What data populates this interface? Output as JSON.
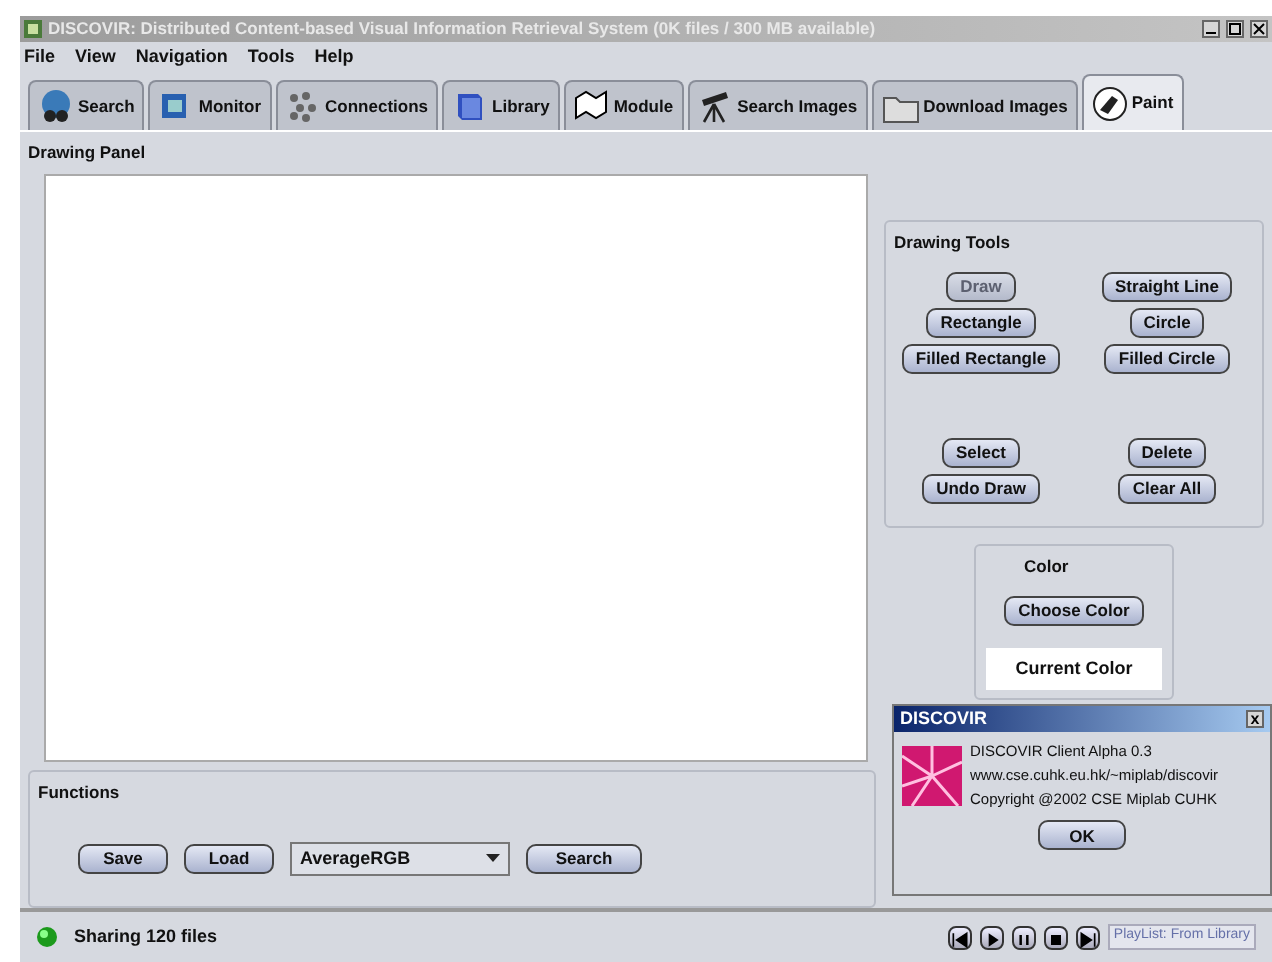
{
  "window": {
    "title": "DISCOVIR: Distributed Content-based Visual Information Retrieval System (0K files / 300 MB available)"
  },
  "menu": [
    "File",
    "View",
    "Navigation",
    "Tools",
    "Help"
  ],
  "tabs": [
    {
      "label": "Search",
      "selected": false
    },
    {
      "label": "Monitor",
      "selected": false
    },
    {
      "label": "Connections",
      "selected": false
    },
    {
      "label": "Library",
      "selected": false
    },
    {
      "label": "Module",
      "selected": false
    },
    {
      "label": "Search Images",
      "selected": false
    },
    {
      "label": "Download Images",
      "selected": false
    },
    {
      "label": "Paint",
      "selected": true
    }
  ],
  "drawing_panel": {
    "title": "Drawing Panel"
  },
  "functions": {
    "title": "Functions",
    "buttons": [
      "Save",
      "Load"
    ],
    "dropdown": "AverageRGB",
    "search_button": "Search"
  },
  "drawing_tools": {
    "title": "Drawing Tools",
    "buttons": [
      {
        "label": "Draw",
        "disabled": true
      },
      {
        "label": "Straight Line",
        "disabled": false
      },
      {
        "label": "Rectangle",
        "disabled": false
      },
      {
        "label": "Circle",
        "disabled": false
      },
      {
        "label": "Filled Rectangle",
        "disabled": false
      },
      {
        "label": "Filled Circle",
        "disabled": false
      }
    ],
    "edit_buttons": [
      {
        "label": "Select",
        "disabled": false
      },
      {
        "label": "Delete",
        "disabled": false
      },
      {
        "label": "Undo Draw",
        "disabled": false
      },
      {
        "label": "Clear All",
        "disabled": false
      }
    ]
  },
  "color": {
    "title": "Color",
    "button": "Choose Color",
    "current": "Current Color"
  },
  "dialog": {
    "title": "DISCOVIR",
    "close": "x",
    "lines": [
      "DISCOVIR Client Alpha 0.3",
      "www.cse.cuhk.eu.hk/~miplab/discovir",
      "Copyright @2002 CSE Miplab CUHK"
    ],
    "button": "OK"
  },
  "status_bar": {
    "text": "Sharing 120 files",
    "playlist": "PlayList: From Library"
  }
}
